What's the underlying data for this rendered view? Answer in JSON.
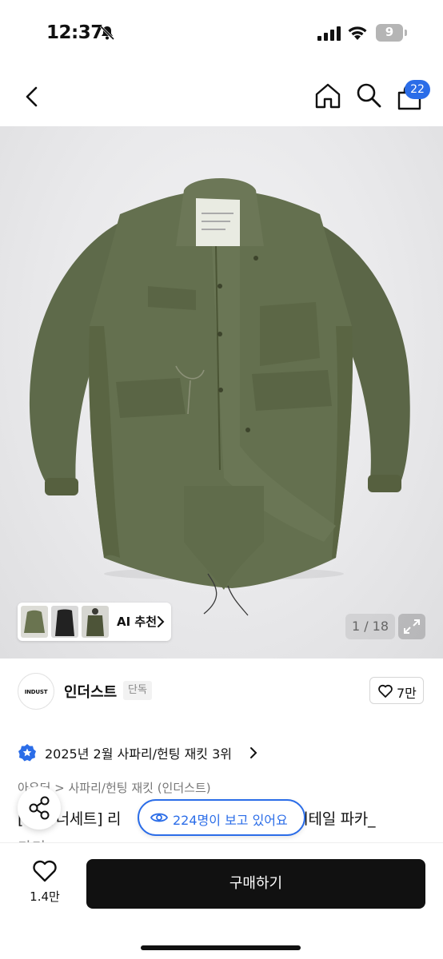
{
  "status_bar": {
    "time": "12:37",
    "battery_level": "9"
  },
  "nav": {
    "cart_count": "22"
  },
  "hero": {
    "ai_recommend_label": "AI 추천",
    "page_counter": "1 / 18"
  },
  "brand": {
    "logo_text": "INDUST",
    "name": "인더스트",
    "exclusive_badge": "단독",
    "likes": "7만"
  },
  "ranking": {
    "text": "2025년 2월 사파리/헌팅 재킷 3위"
  },
  "product": {
    "breadcrumb": "아우터 > 사파리/헌팅 재킷 (인더스트)",
    "title_line1_start": "[커플/너세트] 리",
    "title_line1_end": "피시테일 파카_",
    "title_line2": "카키"
  },
  "overlay": {
    "viewers": "224명이 보고 있어요"
  },
  "bottom_bar": {
    "wish_count": "1.4만",
    "buy_label": "구매하기"
  },
  "colors": {
    "accent": "#2b6de8",
    "buy_button": "#111111",
    "jacket": "#5f6a4c"
  },
  "icons": [
    "back-icon",
    "home-icon",
    "search-icon",
    "cart-icon",
    "heart-icon",
    "star-badge-icon",
    "share-icon",
    "eye-icon",
    "expand-icon",
    "bell-slash-icon"
  ]
}
